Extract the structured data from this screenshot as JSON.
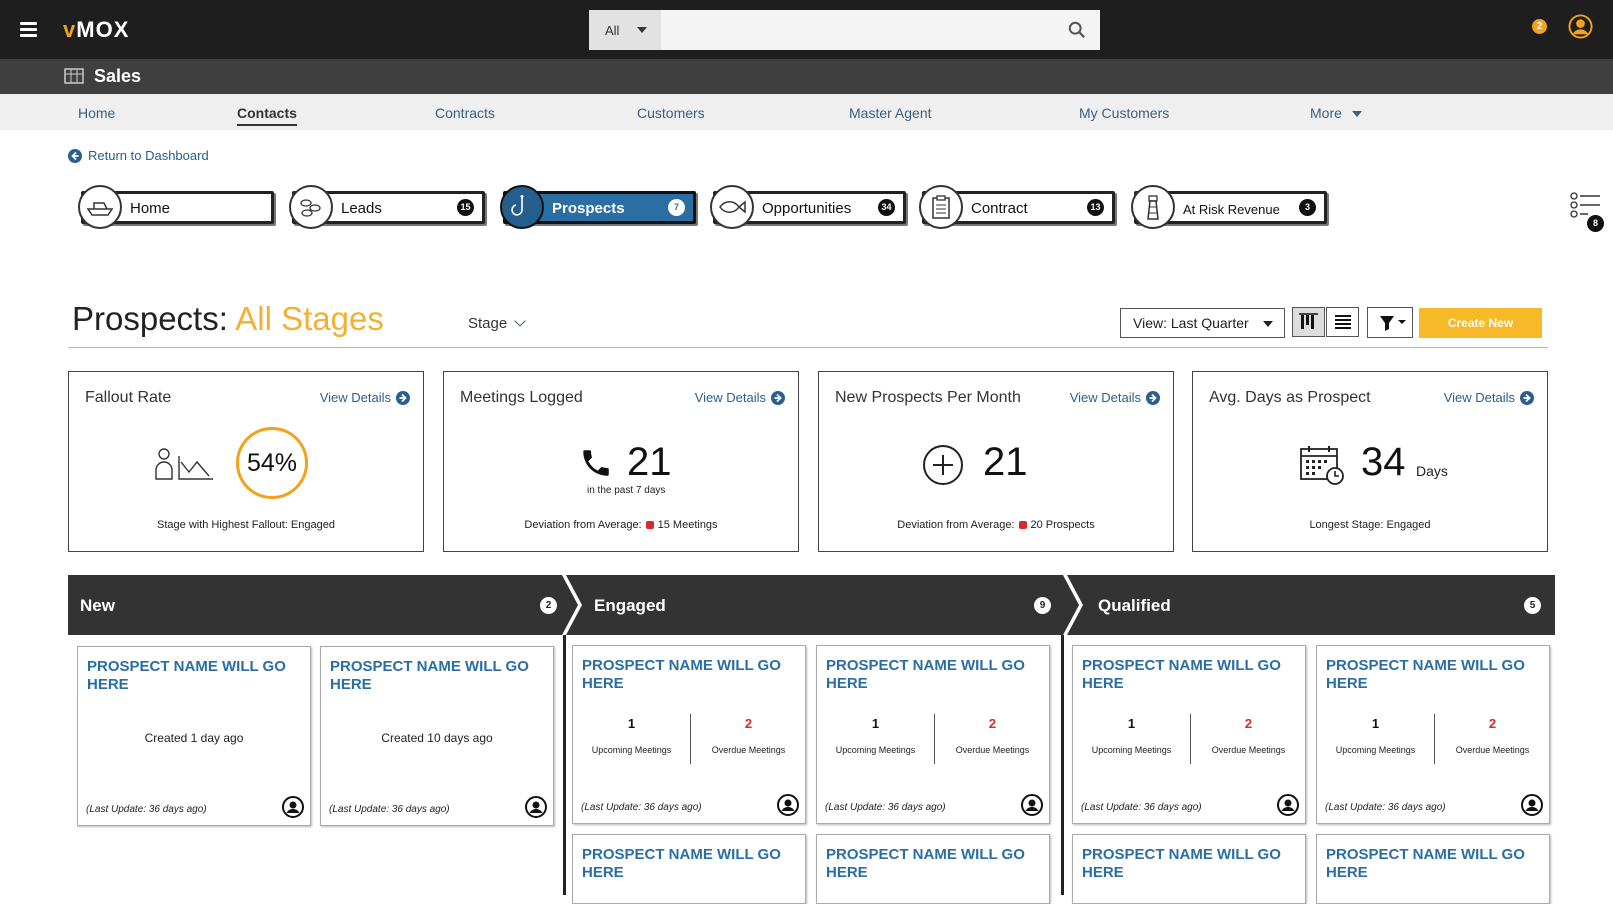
{
  "app": {
    "logo_v": "v",
    "logo_rest": "MOX",
    "notification_count": "2"
  },
  "search": {
    "scope": "All",
    "placeholder": ""
  },
  "module": {
    "title": "Sales"
  },
  "nav": {
    "items": [
      {
        "label": "Home"
      },
      {
        "label": "Contacts"
      },
      {
        "label": "Contracts"
      },
      {
        "label": "Customers"
      },
      {
        "label": "Master Agent"
      },
      {
        "label": "My Customers"
      },
      {
        "label": "More"
      }
    ]
  },
  "back_link": "Return to Dashboard",
  "stages": [
    {
      "label": "Home",
      "count": ""
    },
    {
      "label": "Leads",
      "count": "15"
    },
    {
      "label": "Prospects",
      "count": "7"
    },
    {
      "label": "Opportunities",
      "count": "34"
    },
    {
      "label": "Contract",
      "count": "13"
    },
    {
      "label": "At Risk Revenue",
      "count": "3"
    }
  ],
  "side_list_badge": "8",
  "page": {
    "title_prefix": "Prospects:",
    "title_highlight": "All Stages",
    "stage_filter": "Stage",
    "view_select": "View: Last Quarter",
    "create_button": "Create New"
  },
  "kpis": [
    {
      "title": "Fallout Rate",
      "link": "View Details",
      "value": "54%",
      "footer": "Stage with Highest Fallout: Engaged"
    },
    {
      "title": "Meetings Logged",
      "link": "View Details",
      "value": "21",
      "sub": "in the past 7 days",
      "footer_prefix": "Deviation from Average:",
      "footer_value": "15 Meetings"
    },
    {
      "title": "New Prospects Per Month",
      "link": "View Details",
      "value": "21",
      "footer_prefix": "Deviation from Average:",
      "footer_value": "20 Prospects"
    },
    {
      "title": "Avg. Days as Prospect",
      "link": "View Details",
      "value": "34",
      "unit": "Days",
      "footer": "Longest Stage: Engaged"
    }
  ],
  "lanes": [
    {
      "name": "New",
      "count": "2"
    },
    {
      "name": "Engaged",
      "count": "9"
    },
    {
      "name": "Qualified",
      "count": "5"
    }
  ],
  "card_text": {
    "name": "PROSPECT NAME WILL GO HERE",
    "last_update": "(Last Update: 36 days ago)",
    "created_1": "Created 1 day ago",
    "created_10": "Created 10 days ago",
    "upcoming_count": "1",
    "upcoming_label": "Upcoming Meetings",
    "overdue_count": "2",
    "overdue_label": "Overdue Meetings"
  },
  "colors": {
    "accent": "#f2a31b",
    "primary_blue": "#2b6ea3",
    "topbar": "#1e1e1e",
    "subbar": "#3f3f3f",
    "create": "#f7b928",
    "overdue": "#d9282f"
  }
}
